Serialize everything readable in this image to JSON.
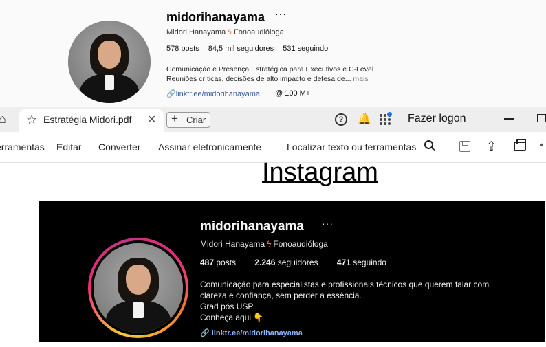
{
  "top_profile": {
    "username": "midorihanayama",
    "more": "···",
    "full_name": "Midori Hanayama",
    "category": "Fonoaudióloga",
    "stats": [
      "578 posts",
      "84,5 mil seguidores",
      "531 seguindo"
    ],
    "bio_line1": "Comunicação e Presença Estratégica para Executivos e C-Level",
    "bio_line2": "Reuniões críticas, decisões de alto impacto e defesa de...",
    "bio_more": "mais",
    "link": "linktr.ee/midorihanayama",
    "threads": "100 M+"
  },
  "browser": {
    "tab_title": "Estratégia Midori.pdf",
    "new_button": "Criar",
    "sign_in": "Fazer logon"
  },
  "toolbar": {
    "items": [
      "erramentas",
      "Editar",
      "Converter",
      "Assinar eletronicamente",
      "Localizar texto ou ferramentas"
    ]
  },
  "document": {
    "heading": "Instagram"
  },
  "dark_profile": {
    "username": "midorihanayama",
    "more": "···",
    "full_name": "Midori Hanayama",
    "category": "Fonoaudióloga",
    "posts_count": "487",
    "posts_label": "posts",
    "followers_count": "2.246",
    "followers_label": "seguidores",
    "following_count": "471",
    "following_label": "seguindo",
    "bio_lines": [
      "Comunicação para especialistas e profissionais técnicos que querem falar com",
      "clareza e confiança, sem perder a essência.",
      "Grad pós USP",
      "Conheça aqui 👇"
    ],
    "link": "linktr.ee/midorihanayama"
  }
}
